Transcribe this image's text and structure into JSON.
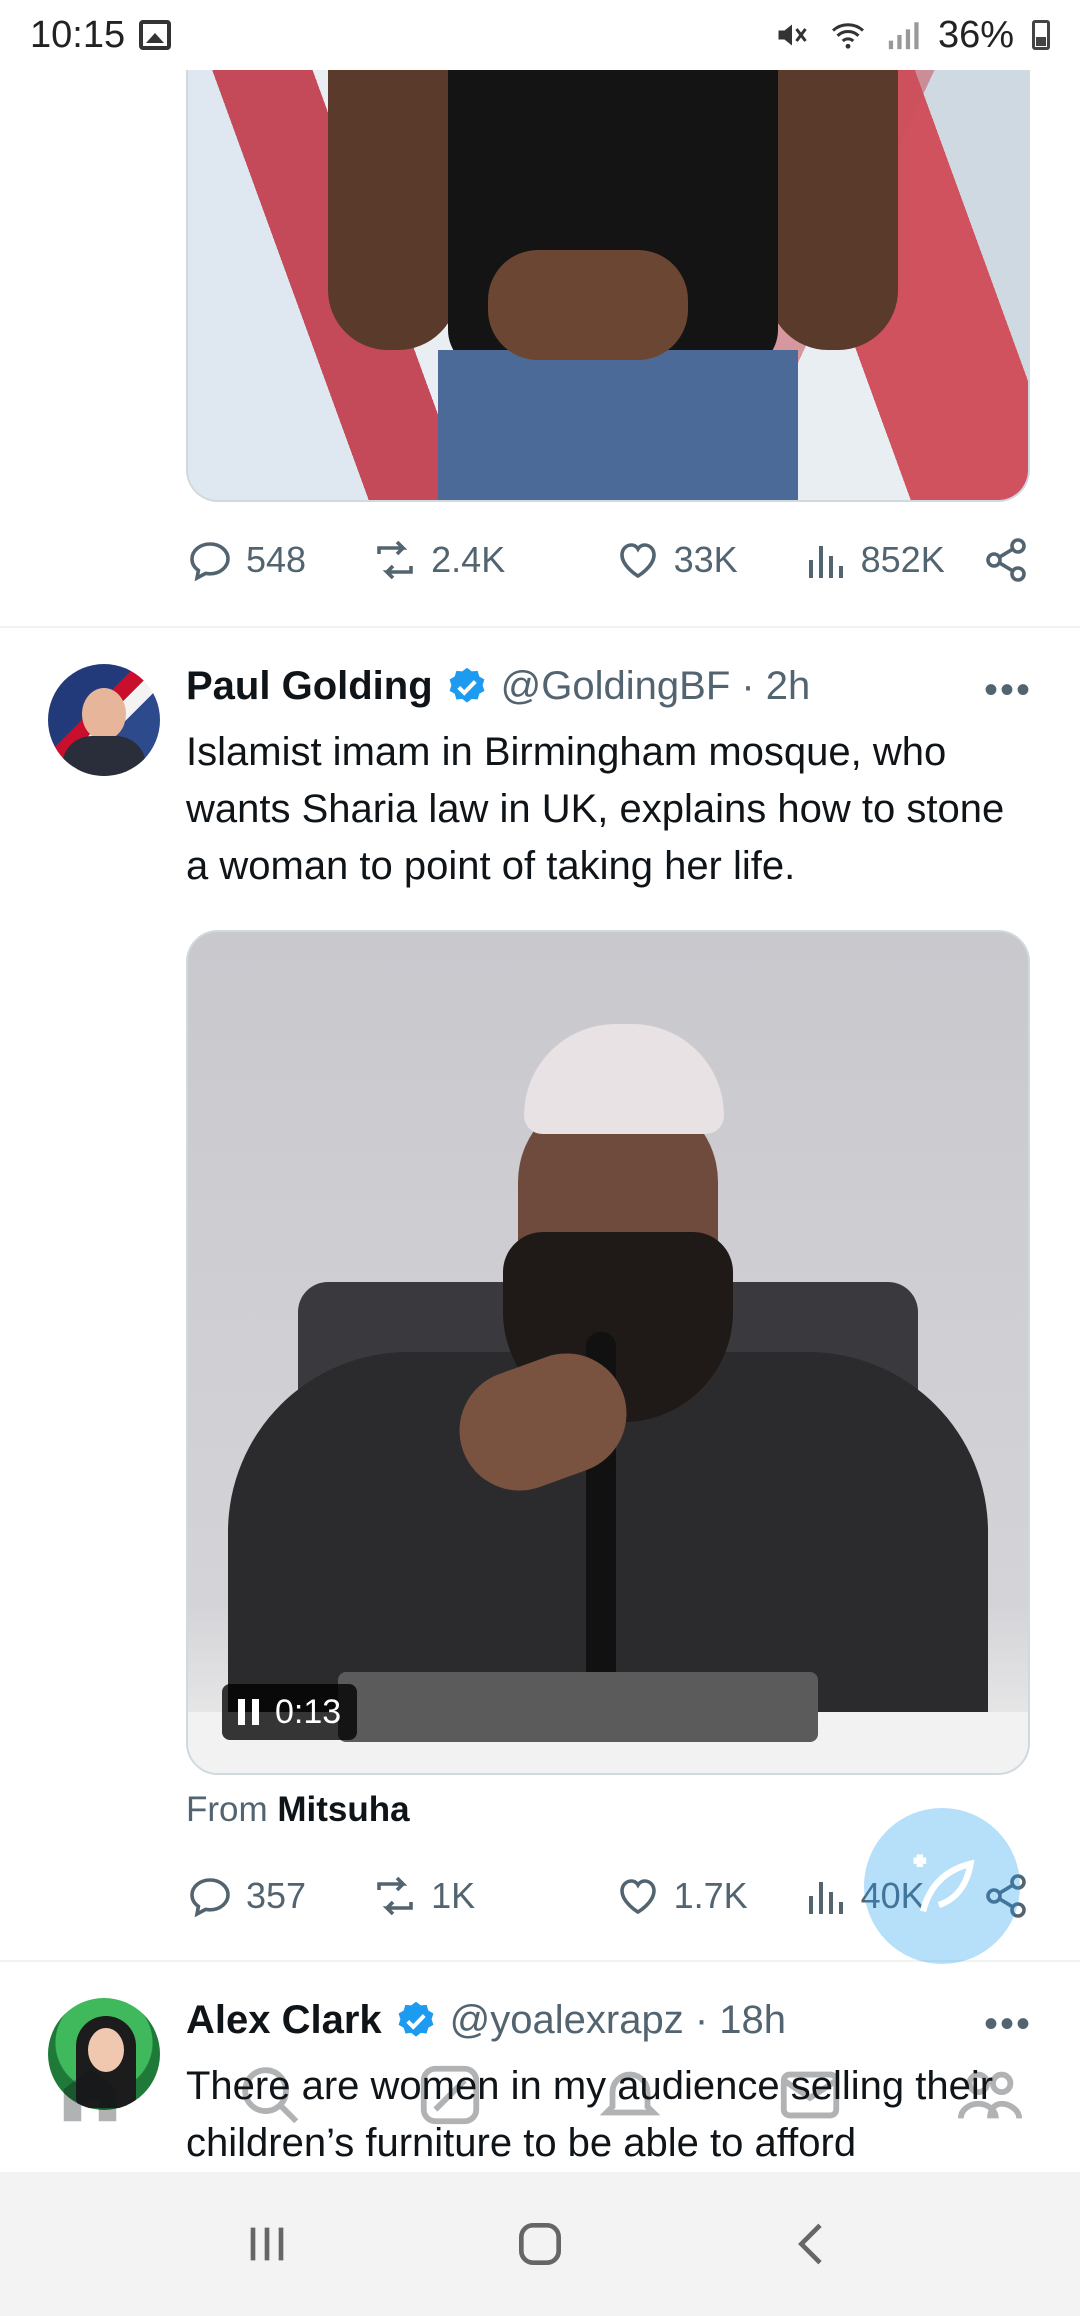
{
  "status_bar": {
    "time": "10:15",
    "battery": "36%"
  },
  "tweets": [
    {
      "actions": {
        "replies": "548",
        "retweets": "2.4K",
        "likes": "33K",
        "views": "852K"
      }
    },
    {
      "name": "Paul Golding",
      "handle": "@GoldingBF · 2h",
      "text": "Islamist imam in Birmingham mosque, who wants Sharia law in UK, explains how to stone a woman to point of taking her life.",
      "video_time": "0:13",
      "from_prefix": "From",
      "from_name": "Mitsuha",
      "actions": {
        "replies": "357",
        "retweets": "1K",
        "likes": "1.7K",
        "views": "40K"
      }
    },
    {
      "name": "Alex Clark",
      "handle": "@yoalexrapz · 18h",
      "text": "There are women in my audience selling their children’s furniture to be able to afford"
    }
  ],
  "more_glyph": "•••",
  "icons": {
    "reply": "reply-icon",
    "retweet": "retweet-icon",
    "like": "heart-icon",
    "views": "views-icon",
    "share": "share-icon",
    "verified": "verified-badge-icon",
    "compose": "compose-tweet-icon"
  },
  "colors": {
    "accent": "#1d9bf0",
    "text": "#0f1419",
    "muted": "#536471"
  }
}
